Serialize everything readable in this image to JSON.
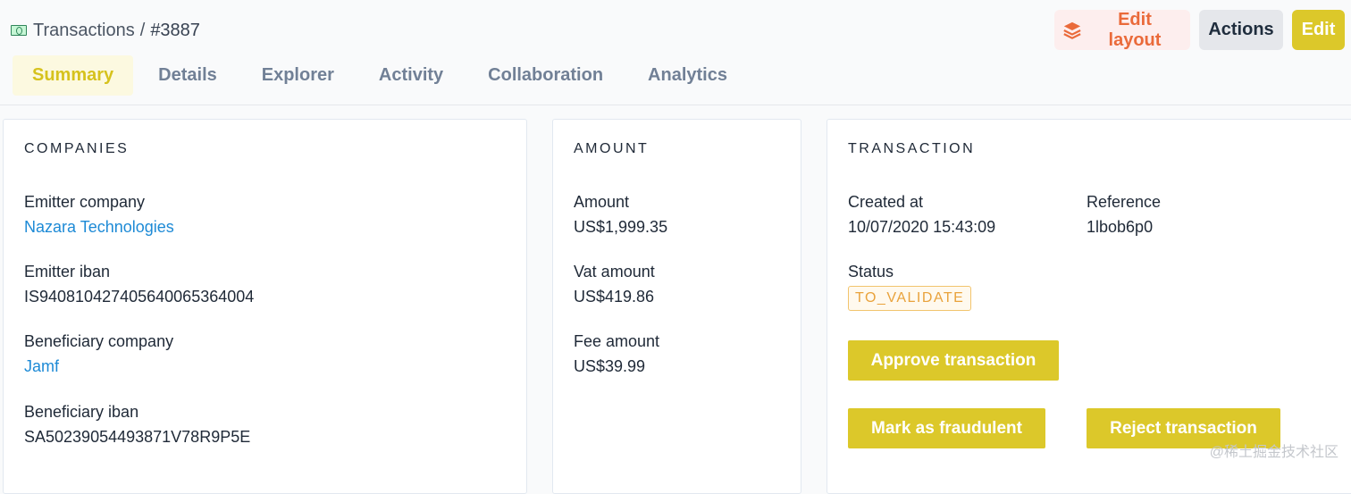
{
  "breadcrumb": {
    "section": "Transactions",
    "separator": "/",
    "record_id": "#3887"
  },
  "toolbar": {
    "edit_layout_label": "Edit layout",
    "actions_label": "Actions",
    "edit_label": "Edit"
  },
  "tabs": [
    {
      "label": "Summary",
      "active": true
    },
    {
      "label": "Details"
    },
    {
      "label": "Explorer"
    },
    {
      "label": "Activity"
    },
    {
      "label": "Collaboration"
    },
    {
      "label": "Analytics"
    }
  ],
  "companies": {
    "title": "COMPANIES",
    "emitter_company_label": "Emitter company",
    "emitter_company_value": "Nazara Technologies",
    "emitter_iban_label": "Emitter iban",
    "emitter_iban_value": "IS940810427405640065364004",
    "beneficiary_company_label": "Beneficiary company",
    "beneficiary_company_value": "Jamf",
    "beneficiary_iban_label": "Beneficiary iban",
    "beneficiary_iban_value": "SA50239054493871V78R9P5E"
  },
  "amount": {
    "title": "AMOUNT",
    "amount_label": "Amount",
    "amount_value": "US$1,999.35",
    "vat_label": "Vat amount",
    "vat_value": "US$419.86",
    "fee_label": "Fee amount",
    "fee_value": "US$39.99"
  },
  "transaction": {
    "title": "TRANSACTION",
    "created_label": "Created at",
    "created_value": "10/07/2020 15:43:09",
    "reference_label": "Reference",
    "reference_value": "1lbob6p0",
    "status_label": "Status",
    "status_value": "TO_VALIDATE",
    "approve_label": "Approve transaction",
    "fraud_label": "Mark as fraudulent",
    "reject_label": "Reject transaction"
  },
  "watermark": "@稀土掘金技术社区",
  "colors": {
    "accent": "#dcc82a",
    "link": "#1d8ad6",
    "edit_layout": "#ea6a3a",
    "status": "#e9a23b"
  }
}
